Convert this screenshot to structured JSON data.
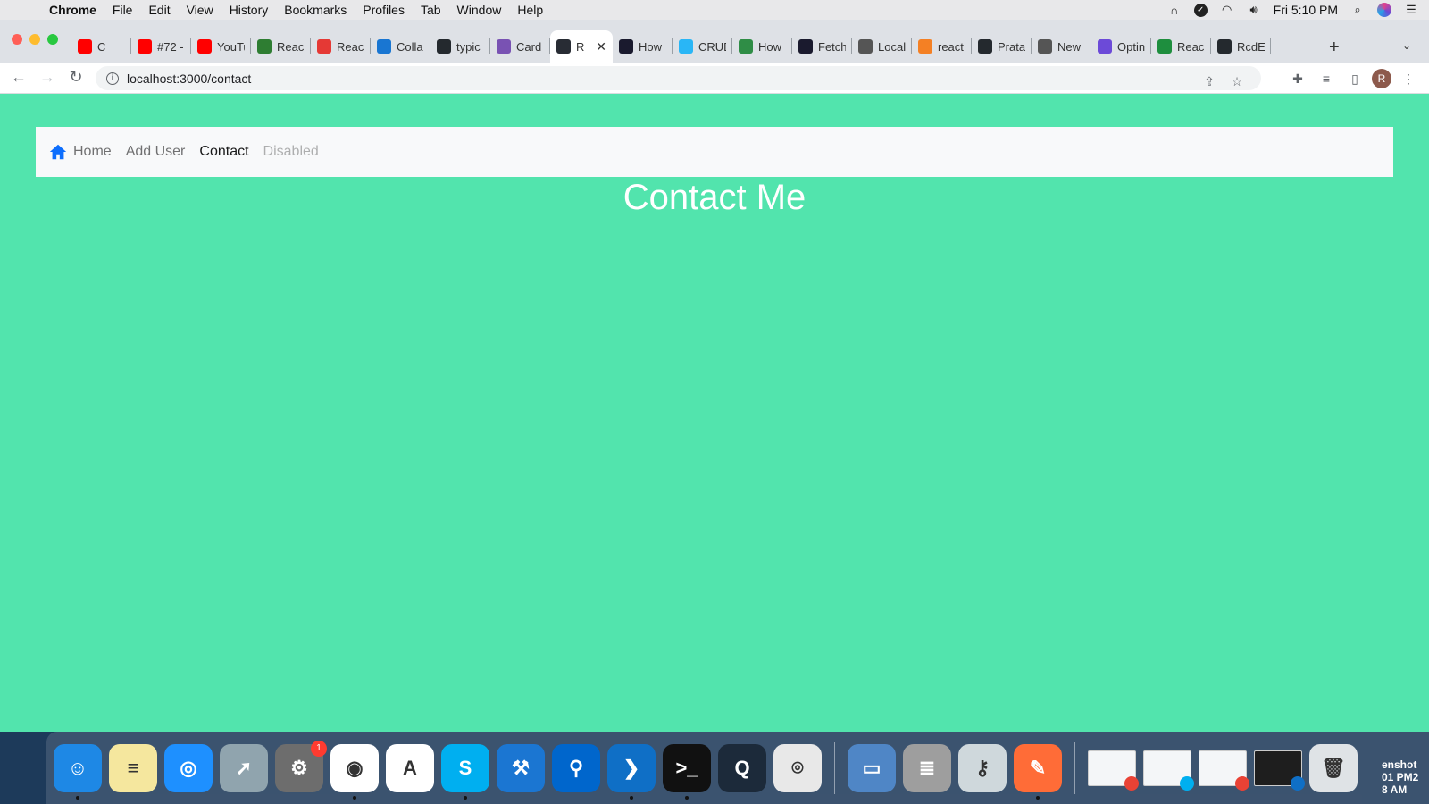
{
  "menubar": {
    "apple": "",
    "app_name": "Chrome",
    "items": [
      "File",
      "Edit",
      "View",
      "History",
      "Bookmarks",
      "Profiles",
      "Tab",
      "Window",
      "Help"
    ],
    "clock": "Fri 5:10 PM"
  },
  "tabs": [
    {
      "label": "C",
      "favicon": "youtube-icon",
      "color": "#ff0000"
    },
    {
      "label": "#72 -",
      "favicon": "youtube-icon",
      "color": "#ff0000"
    },
    {
      "label": "YouTu",
      "favicon": "youtube-icon",
      "color": "#ff0000"
    },
    {
      "label": "Reac",
      "favicon": "w3-icon",
      "color": "#2e7d32"
    },
    {
      "label": "Reac",
      "favicon": "logo-icon",
      "color": "#e53935"
    },
    {
      "label": "Colla",
      "favicon": "collab-icon",
      "color": "#1976d2"
    },
    {
      "label": "typic",
      "favicon": "github-icon",
      "color": "#24292e"
    },
    {
      "label": "Card",
      "favicon": "bootstrap-icon",
      "color": "#7952b3"
    },
    {
      "label": "R",
      "favicon": "react-icon",
      "color": "#282c34",
      "active": true
    },
    {
      "label": "How",
      "favicon": "a-icon",
      "color": "#1a1a2e"
    },
    {
      "label": "CRUD",
      "favicon": "crud-icon",
      "color": "#29b6f6"
    },
    {
      "label": "How",
      "favicon": "gfg-icon",
      "color": "#2f8d46"
    },
    {
      "label": "Fetch",
      "favicon": "a-icon",
      "color": "#1a1a2e"
    },
    {
      "label": "Local",
      "favicon": "diamond-icon",
      "color": "#555555"
    },
    {
      "label": "react",
      "favicon": "stackoverflow-icon",
      "color": "#f48024"
    },
    {
      "label": "Prata",
      "favicon": "github-icon",
      "color": "#24292e"
    },
    {
      "label": "New",
      "favicon": "chrome-icon",
      "color": "#555555"
    },
    {
      "label": "Optin",
      "favicon": "a-icon",
      "color": "#6c4ad8"
    },
    {
      "label": "Reac",
      "favicon": "plus-icon",
      "color": "#1e8e3e"
    },
    {
      "label": "RcdE",
      "favicon": "github-icon",
      "color": "#24292e"
    }
  ],
  "address": {
    "url": "localhost:3000/contact"
  },
  "profile": {
    "initial": "R"
  },
  "navbar": {
    "links": [
      {
        "label": "Home",
        "state": "normal"
      },
      {
        "label": "Add User",
        "state": "normal"
      },
      {
        "label": "Contact",
        "state": "active"
      },
      {
        "label": "Disabled",
        "state": "disabled"
      }
    ]
  },
  "page": {
    "title": "Contact Me",
    "background": "#52e4ad"
  },
  "dock": {
    "apps": [
      {
        "name": "finder-icon",
        "color": "#1e88e5",
        "glyph": "☺",
        "running": true
      },
      {
        "name": "notes-icon",
        "color": "#f5e79e",
        "glyph": "≡"
      },
      {
        "name": "safari-icon",
        "color": "#1e90ff",
        "glyph": "◎"
      },
      {
        "name": "launchpad-icon",
        "color": "#90a4ae",
        "glyph": "➚"
      },
      {
        "name": "system-preferences-icon",
        "color": "#6d6d6d",
        "glyph": "⚙",
        "badge": "1"
      },
      {
        "name": "chrome-icon",
        "color": "#ffffff",
        "glyph": "◉",
        "running": true
      },
      {
        "name": "xcode-instruments-icon",
        "color": "#ffffff",
        "glyph": "A"
      },
      {
        "name": "skype-icon",
        "color": "#00aff0",
        "glyph": "S",
        "running": true
      },
      {
        "name": "xcode-icon",
        "color": "#1b76d2",
        "glyph": "⚒"
      },
      {
        "name": "maps-pin-icon",
        "color": "#0066cc",
        "glyph": "⚲"
      },
      {
        "name": "vscode-icon",
        "color": "#0f6fc6",
        "glyph": "❯",
        "running": true
      },
      {
        "name": "terminal-icon",
        "color": "#111111",
        "glyph": ">_",
        "running": true
      },
      {
        "name": "quicktime-icon",
        "color": "#1c2a3a",
        "glyph": "Q"
      },
      {
        "name": "screenshot-icon",
        "color": "#e8e8e8",
        "glyph": "⌾"
      }
    ],
    "utilities": [
      {
        "name": "preview-icon",
        "color": "#4f86c6",
        "glyph": "▭"
      },
      {
        "name": "database-icon",
        "color": "#9e9e9e",
        "glyph": "≣"
      },
      {
        "name": "keychain-icon",
        "color": "#cfd8dc",
        "glyph": "⚷"
      },
      {
        "name": "postman-icon",
        "color": "#ff6c37",
        "glyph": "✎",
        "running": true
      }
    ],
    "minimized": [
      {
        "name": "chrome-window-thumbnail",
        "dark": false,
        "mini": "#e94235"
      },
      {
        "name": "skype-window-thumbnail",
        "dark": false,
        "mini": "#00aff0"
      },
      {
        "name": "chrome-window-thumbnail",
        "dark": false,
        "mini": "#e94235"
      },
      {
        "name": "vscode-window-thumbnail",
        "dark": true,
        "mini": "#0f6fc6"
      }
    ],
    "trash": {
      "name": "trash-icon",
      "color": "#dfe3e6",
      "glyph": "🗑"
    },
    "screenshot_label": "enshot\n01 PM2\n8 AM"
  }
}
